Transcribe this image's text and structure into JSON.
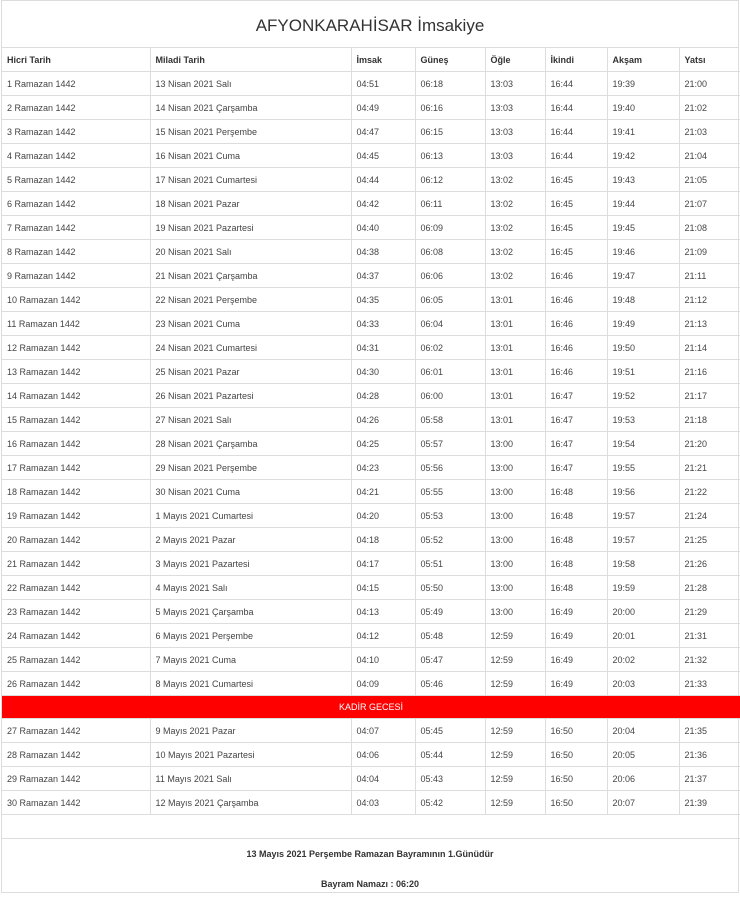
{
  "page": {
    "title": "AFYONKARAHİSAR İmsakiye",
    "headers": [
      "Hicri Tarih",
      "Miladi Tarih",
      "İmsak",
      "Güneş",
      "Öğle",
      "İkindi",
      "Akşam",
      "Yatsı"
    ],
    "rows_before": [
      [
        "1 Ramazan 1442",
        "13 Nisan 2021 Salı",
        "04:51",
        "06:18",
        "13:03",
        "16:44",
        "19:39",
        "21:00"
      ],
      [
        "2 Ramazan 1442",
        "14 Nisan 2021 Çarşamba",
        "04:49",
        "06:16",
        "13:03",
        "16:44",
        "19:40",
        "21:02"
      ],
      [
        "3 Ramazan 1442",
        "15 Nisan 2021 Perşembe",
        "04:47",
        "06:15",
        "13:03",
        "16:44",
        "19:41",
        "21:03"
      ],
      [
        "4 Ramazan 1442",
        "16 Nisan 2021 Cuma",
        "04:45",
        "06:13",
        "13:03",
        "16:44",
        "19:42",
        "21:04"
      ],
      [
        "5 Ramazan 1442",
        "17 Nisan 2021 Cumartesi",
        "04:44",
        "06:12",
        "13:02",
        "16:45",
        "19:43",
        "21:05"
      ],
      [
        "6 Ramazan 1442",
        "18 Nisan 2021 Pazar",
        "04:42",
        "06:11",
        "13:02",
        "16:45",
        "19:44",
        "21:07"
      ],
      [
        "7 Ramazan 1442",
        "19 Nisan 2021 Pazartesi",
        "04:40",
        "06:09",
        "13:02",
        "16:45",
        "19:45",
        "21:08"
      ],
      [
        "8 Ramazan 1442",
        "20 Nisan 2021 Salı",
        "04:38",
        "06:08",
        "13:02",
        "16:45",
        "19:46",
        "21:09"
      ],
      [
        "9 Ramazan 1442",
        "21 Nisan 2021 Çarşamba",
        "04:37",
        "06:06",
        "13:02",
        "16:46",
        "19:47",
        "21:11"
      ],
      [
        "10 Ramazan 1442",
        "22 Nisan 2021 Perşembe",
        "04:35",
        "06:05",
        "13:01",
        "16:46",
        "19:48",
        "21:12"
      ],
      [
        "11 Ramazan 1442",
        "23 Nisan 2021 Cuma",
        "04:33",
        "06:04",
        "13:01",
        "16:46",
        "19:49",
        "21:13"
      ],
      [
        "12 Ramazan 1442",
        "24 Nisan 2021 Cumartesi",
        "04:31",
        "06:02",
        "13:01",
        "16:46",
        "19:50",
        "21:14"
      ],
      [
        "13 Ramazan 1442",
        "25 Nisan 2021 Pazar",
        "04:30",
        "06:01",
        "13:01",
        "16:46",
        "19:51",
        "21:16"
      ],
      [
        "14 Ramazan 1442",
        "26 Nisan 2021 Pazartesi",
        "04:28",
        "06:00",
        "13:01",
        "16:47",
        "19:52",
        "21:17"
      ],
      [
        "15 Ramazan 1442",
        "27 Nisan 2021 Salı",
        "04:26",
        "05:58",
        "13:01",
        "16:47",
        "19:53",
        "21:18"
      ],
      [
        "16 Ramazan 1442",
        "28 Nisan 2021 Çarşamba",
        "04:25",
        "05:57",
        "13:00",
        "16:47",
        "19:54",
        "21:20"
      ],
      [
        "17 Ramazan 1442",
        "29 Nisan 2021 Perşembe",
        "04:23",
        "05:56",
        "13:00",
        "16:47",
        "19:55",
        "21:21"
      ],
      [
        "18 Ramazan 1442",
        "30 Nisan 2021 Cuma",
        "04:21",
        "05:55",
        "13:00",
        "16:48",
        "19:56",
        "21:22"
      ],
      [
        "19 Ramazan 1442",
        "1 Mayıs 2021 Cumartesi",
        "04:20",
        "05:53",
        "13:00",
        "16:48",
        "19:57",
        "21:24"
      ],
      [
        "20 Ramazan 1442",
        "2 Mayıs 2021 Pazar",
        "04:18",
        "05:52",
        "13:00",
        "16:48",
        "19:57",
        "21:25"
      ],
      [
        "21 Ramazan 1442",
        "3 Mayıs 2021 Pazartesi",
        "04:17",
        "05:51",
        "13:00",
        "16:48",
        "19:58",
        "21:26"
      ],
      [
        "22 Ramazan 1442",
        "4 Mayıs 2021 Salı",
        "04:15",
        "05:50",
        "13:00",
        "16:48",
        "19:59",
        "21:28"
      ],
      [
        "23 Ramazan 1442",
        "5 Mayıs 2021 Çarşamba",
        "04:13",
        "05:49",
        "13:00",
        "16:49",
        "20:00",
        "21:29"
      ],
      [
        "24 Ramazan 1442",
        "6 Mayıs 2021 Perşembe",
        "04:12",
        "05:48",
        "12:59",
        "16:49",
        "20:01",
        "21:31"
      ],
      [
        "25 Ramazan 1442",
        "7 Mayıs 2021 Cuma",
        "04:10",
        "05:47",
        "12:59",
        "16:49",
        "20:02",
        "21:32"
      ],
      [
        "26 Ramazan 1442",
        "8 Mayıs 2021 Cumartesi",
        "04:09",
        "05:46",
        "12:59",
        "16:49",
        "20:03",
        "21:33"
      ]
    ],
    "special_row": "KADİR GECESİ",
    "rows_after": [
      [
        "27 Ramazan 1442",
        "9 Mayıs 2021 Pazar",
        "04:07",
        "05:45",
        "12:59",
        "16:50",
        "20:04",
        "21:35"
      ],
      [
        "28 Ramazan 1442",
        "10 Mayıs 2021 Pazartesi",
        "04:06",
        "05:44",
        "12:59",
        "16:50",
        "20:05",
        "21:36"
      ],
      [
        "29 Ramazan 1442",
        "11 Mayıs 2021 Salı",
        "04:04",
        "05:43",
        "12:59",
        "16:50",
        "20:06",
        "21:37"
      ],
      [
        "30 Ramazan 1442",
        "12 Mayıs 2021 Çarşamba",
        "04:03",
        "05:42",
        "12:59",
        "16:50",
        "20:07",
        "21:39"
      ]
    ],
    "note_bayram": "13 Mayıs 2021 Perşembe Ramazan Bayramının 1.Günüdür",
    "note_namaz": "Bayram Namazı : 06:20",
    "colors": {
      "special_bg": "#ff0000",
      "border": "#dddddd"
    }
  }
}
